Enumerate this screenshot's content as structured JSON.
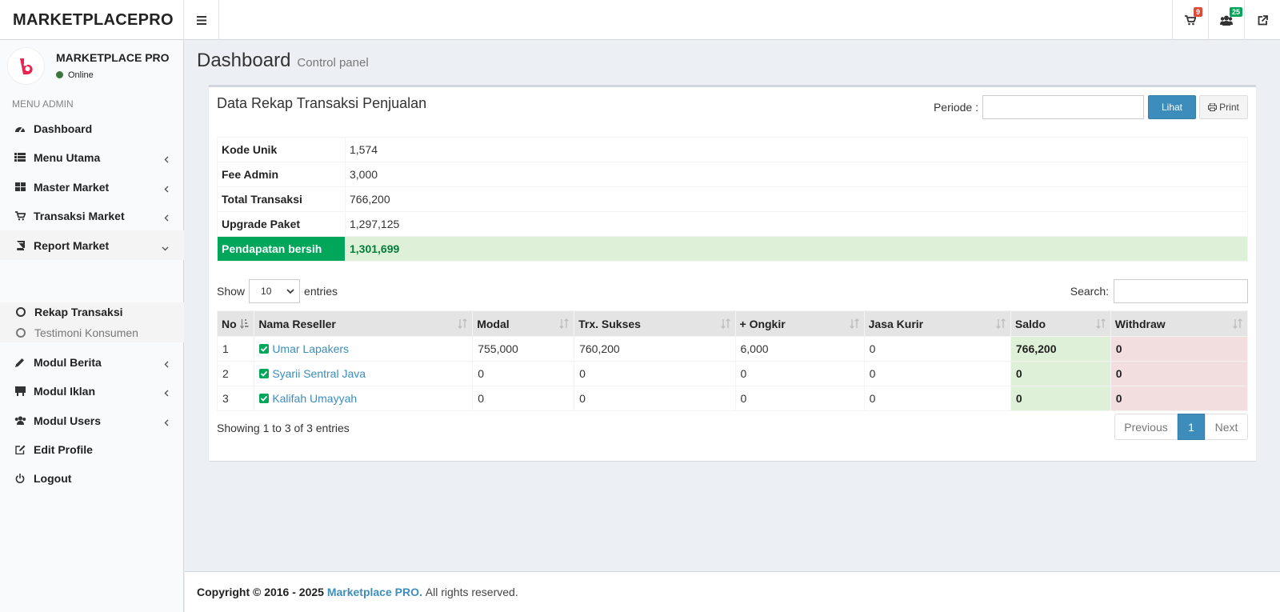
{
  "app": {
    "logo": "MARKETPLACEPRO"
  },
  "header": {
    "cart_badge": "9",
    "users_badge": "25",
    "cart_badge_color": "#dd4b39",
    "users_badge_color": "#00a65a"
  },
  "user": {
    "name": "MARKETPLACE PRO",
    "status": "Online"
  },
  "sidebar": {
    "header": "MENU ADMIN",
    "items": [
      {
        "label": "Dashboard",
        "icon": "dashboard-icon"
      },
      {
        "label": "Menu Utama",
        "icon": "list-icon"
      },
      {
        "label": "Master Market",
        "icon": "grid-icon"
      },
      {
        "label": "Transaksi Market",
        "icon": "cart-icon"
      },
      {
        "label": "Report Market",
        "icon": "book-icon"
      },
      {
        "label": "Modul Berita",
        "icon": "pencil-icon"
      },
      {
        "label": "Modul Iklan",
        "icon": "billboard-icon"
      },
      {
        "label": "Modul Users",
        "icon": "users-icon"
      },
      {
        "label": "Edit Profile",
        "icon": "edit-icon"
      },
      {
        "label": "Logout",
        "icon": "power-icon"
      }
    ],
    "subitems": [
      {
        "label": "Rekap Transaksi"
      },
      {
        "label": "Testimoni Konsumen"
      }
    ]
  },
  "page": {
    "title": "Dashboard",
    "subtitle": "Control panel"
  },
  "box": {
    "title": "Data Rekap Transaksi Penjualan",
    "periode_label": "Periode :",
    "periode_value": "",
    "lihat_label": "Lihat",
    "print_label": "Print"
  },
  "summary": [
    {
      "key": "Kode Unik",
      "value": "1,574"
    },
    {
      "key": "Fee Admin",
      "value": "3,000"
    },
    {
      "key": "Total Transaksi",
      "value": "766,200"
    },
    {
      "key": "Upgrade Paket",
      "value": "1,297,125"
    },
    {
      "key": "Pendapatan bersih",
      "value": "1,301,699"
    }
  ],
  "table_controls": {
    "show_label": "Show",
    "page_size": "10",
    "entries_label": "entries",
    "search_label": "Search:",
    "search_value": ""
  },
  "table": {
    "columns": [
      "No",
      "Nama Reseller",
      "Modal",
      "Trx. Sukses",
      "+ Ongkir",
      "Jasa Kurir",
      "Saldo",
      "Withdraw"
    ],
    "rows": [
      {
        "no": "1",
        "name": "Umar Lapakers",
        "modal": "755,000",
        "trx": "760,200",
        "ongkir": "6,000",
        "kurir": "0",
        "saldo": "766,200",
        "withdraw": "0"
      },
      {
        "no": "2",
        "name": "Syarii Sentral Java",
        "modal": "0",
        "trx": "0",
        "ongkir": "0",
        "kurir": "0",
        "saldo": "0",
        "withdraw": "0"
      },
      {
        "no": "3",
        "name": "Kalifah Umayyah",
        "modal": "0",
        "trx": "0",
        "ongkir": "0",
        "kurir": "0",
        "saldo": "0",
        "withdraw": "0"
      }
    ]
  },
  "pagination": {
    "info": "Showing 1 to 3 of 3 entries",
    "previous": "Previous",
    "current": "1",
    "next": "Next"
  },
  "footer": {
    "copyright": "Copyright © 2016 - 2025",
    "brand": "Marketplace PRO.",
    "rights": "All rights reserved."
  }
}
